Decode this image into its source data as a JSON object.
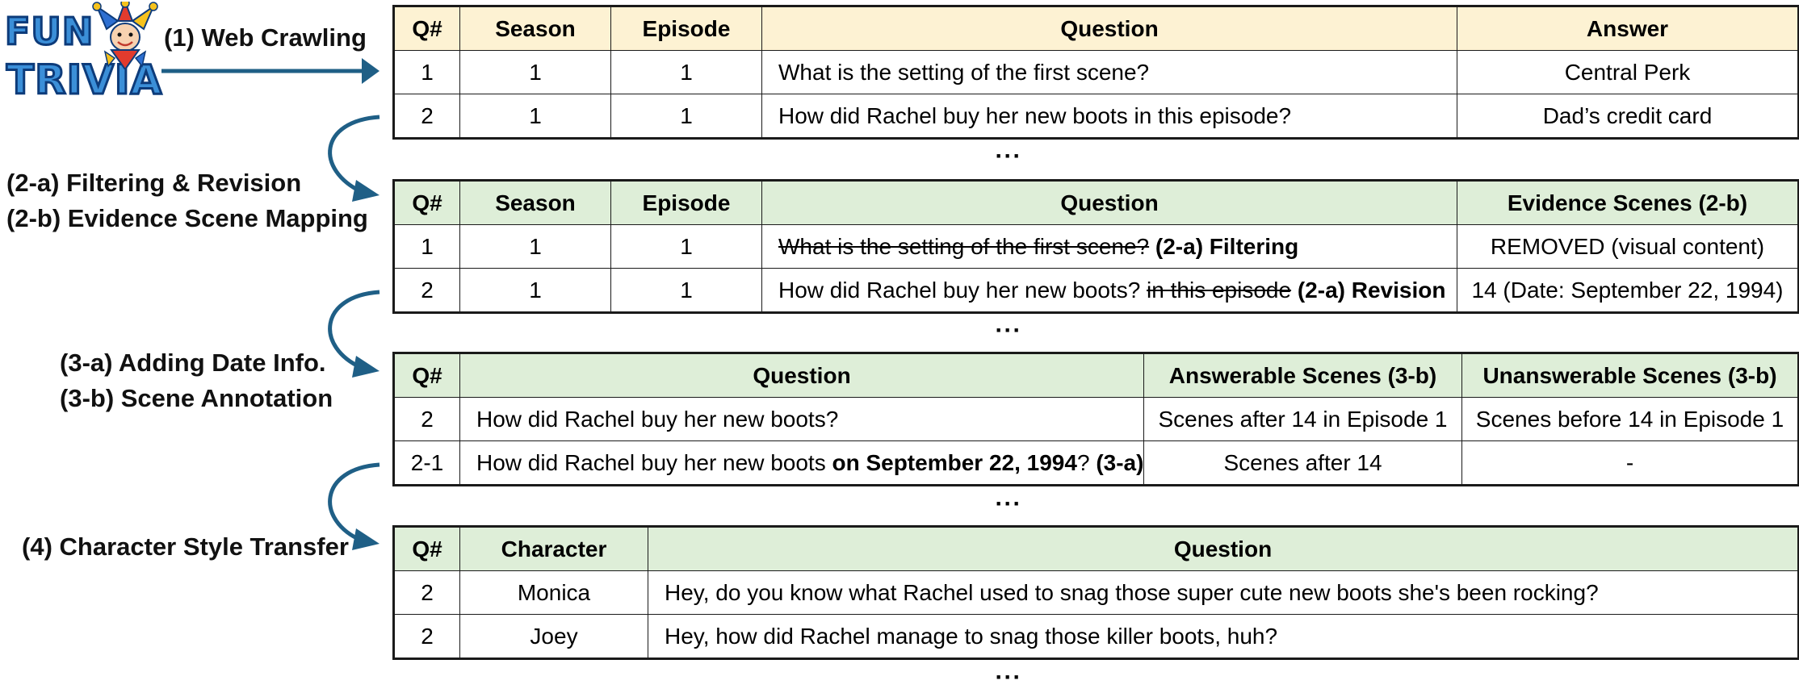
{
  "logo": {
    "line1": "FUN",
    "line2": "TRIVIA"
  },
  "steps": {
    "s1": "(1) Web Crawling",
    "s2a": "(2-a) Filtering & Revision",
    "s2b": "(2-b) Evidence Scene Mapping",
    "s3a": "(3-a) Adding Date Info.",
    "s3b": "(3-b) Scene Annotation",
    "s4": "(4) Character Style Transfer"
  },
  "ellipsis": "···",
  "table1": {
    "headers": [
      "Q#",
      "Season",
      "Episode",
      "Question",
      "Answer"
    ],
    "rows": [
      {
        "q": "1",
        "season": "1",
        "episode": "1",
        "question": "What is the setting of the first scene?",
        "answer": "Central Perk"
      },
      {
        "q": "2",
        "season": "1",
        "episode": "1",
        "question": "How did Rachel buy her new boots in this episode?",
        "answer": "Dad’s credit card"
      }
    ]
  },
  "table2": {
    "headers": [
      "Q#",
      "Season",
      "Episode",
      "Question",
      "Evidence Scenes (2-b)"
    ],
    "rows": [
      {
        "q": "1",
        "season": "1",
        "episode": "1",
        "question_struck": "What is the setting of the first scene?",
        "question_tag": "(2-a) Filtering",
        "evidence": "REMOVED (visual content)"
      },
      {
        "q": "2",
        "season": "1",
        "episode": "1",
        "question": "How did Rachel buy her new boots?",
        "question_struck": "in this episode",
        "question_tag": "(2-a) Revision",
        "evidence": "14 (Date: September 22, 1994)"
      }
    ]
  },
  "table3": {
    "headers": [
      "Q#",
      "Question",
      "Answerable Scenes (3-b)",
      "Unanswerable Scenes (3-b)"
    ],
    "rows": [
      {
        "q": "2",
        "question": "How did Rachel buy her new boots?",
        "answerable": "Scenes after 14 in Episode 1",
        "unanswerable": "Scenes before 14 in Episode 1"
      },
      {
        "q": "2-1",
        "question_pre": "How did Rachel buy her new boots",
        "question_bold": "on September 22, 1994",
        "question_post": "?",
        "question_tag": "(3-a)",
        "answerable": "Scenes after 14",
        "unanswerable": "-"
      }
    ]
  },
  "table4": {
    "headers": [
      "Q#",
      "Character",
      "Question"
    ],
    "rows": [
      {
        "q": "2",
        "character": "Monica",
        "question": "Hey, do you know what Rachel used to snag those super cute new boots she's been rocking?"
      },
      {
        "q": "2",
        "character": "Joey",
        "question": "Hey, how did Rachel manage to snag those killer boots, huh?"
      }
    ]
  },
  "colors": {
    "arrow": "#1f5f86",
    "header_yellow": "#fdf2d3",
    "header_green": "#deeed8",
    "logo_blue": "#3b8fd8",
    "logo_outline": "#0d3b7a"
  }
}
